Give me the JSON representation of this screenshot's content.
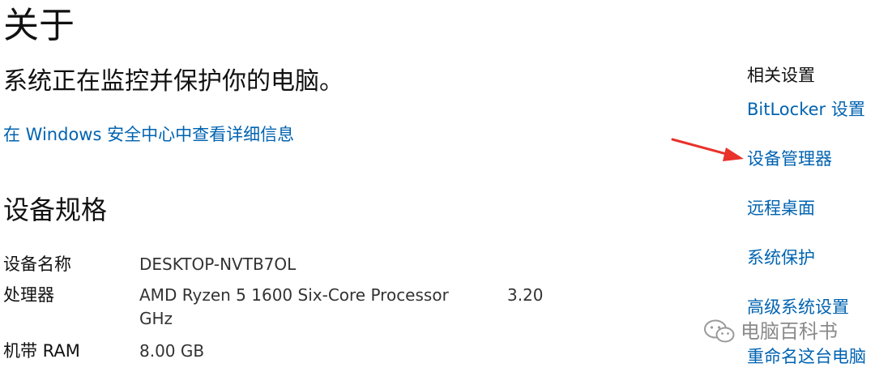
{
  "page": {
    "title": "关于",
    "status": "系统正在监控并保护你的电脑。",
    "security_link": "在 Windows 安全中心中查看详细信息"
  },
  "specs": {
    "heading": "设备规格",
    "device_name_label": "设备名称",
    "device_name_value": "DESKTOP-NVTB7OL",
    "processor_label": "处理器",
    "processor_value_line1": "AMD Ryzen 5 1600 Six-Core Processor",
    "processor_value_line2": "GHz",
    "processor_speed": "3.20",
    "ram_label": "机带 RAM",
    "ram_value": "8.00 GB"
  },
  "related": {
    "title": "相关设置",
    "links": [
      "BitLocker 设置",
      "设备管理器",
      "远程桌面",
      "系统保护",
      "高级系统设置",
      "重命名这台电脑"
    ]
  },
  "watermark": {
    "text": "电脑百科书",
    "icon": "wechat-icon"
  },
  "colors": {
    "link": "#0063b1",
    "arrow": "#e8322b",
    "watermark": "#8a8a8a"
  }
}
